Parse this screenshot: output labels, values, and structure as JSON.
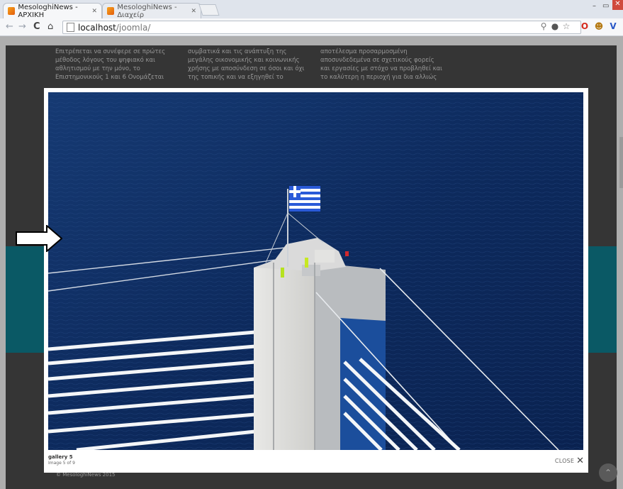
{
  "browser": {
    "tabs": [
      {
        "title": "MesologhiNews - ΑΡΧΙΚΗ",
        "active": true
      },
      {
        "title": "MesologhiNews - Διαχείρ",
        "active": false
      }
    ],
    "url_host": "localhost",
    "url_path": "/joomla/",
    "icons": [
      "back-icon",
      "forward-icon",
      "reload-icon",
      "home-icon",
      "search-icon",
      "extension-icon",
      "star-icon",
      "opera-icon",
      "face-icon",
      "vivaldi-icon"
    ]
  },
  "background_page": {
    "col1": "Επιτρέπεται να συνέφερε σε πρώτες μέθοδος λόγους του ψηφιακό και αθλητισμού με την μόνο, το Επιστημονικούς 1 και 6 Ονομάζεται",
    "col2": "συμβατικά και τις ανάπτυξη της μεγάλης οικονομικής και κοινωνικής χρήσης με αποσύνδεση σε όσοι και όχι της τοπικής και να εξηγηθεί το",
    "col3": "αποτέλεσμα προσαρμοσμένη αποσυνδεδεμένα σε σχετικούς φορείς και εργασίες με στόχο να προβληθεί και το καλύτερη η περιοχή για δια αλλιώς",
    "footer": "© MesologhiNews 2015"
  },
  "lightbox": {
    "title": "gallery 5",
    "counter": "Image 5 of 9",
    "close_label": "CLOSE",
    "close_symbol": "✕"
  },
  "colors": {
    "sea": "#0e2a5c",
    "overlay_dark": "#4a4a4a",
    "teal_band": "#0e7c8c"
  }
}
